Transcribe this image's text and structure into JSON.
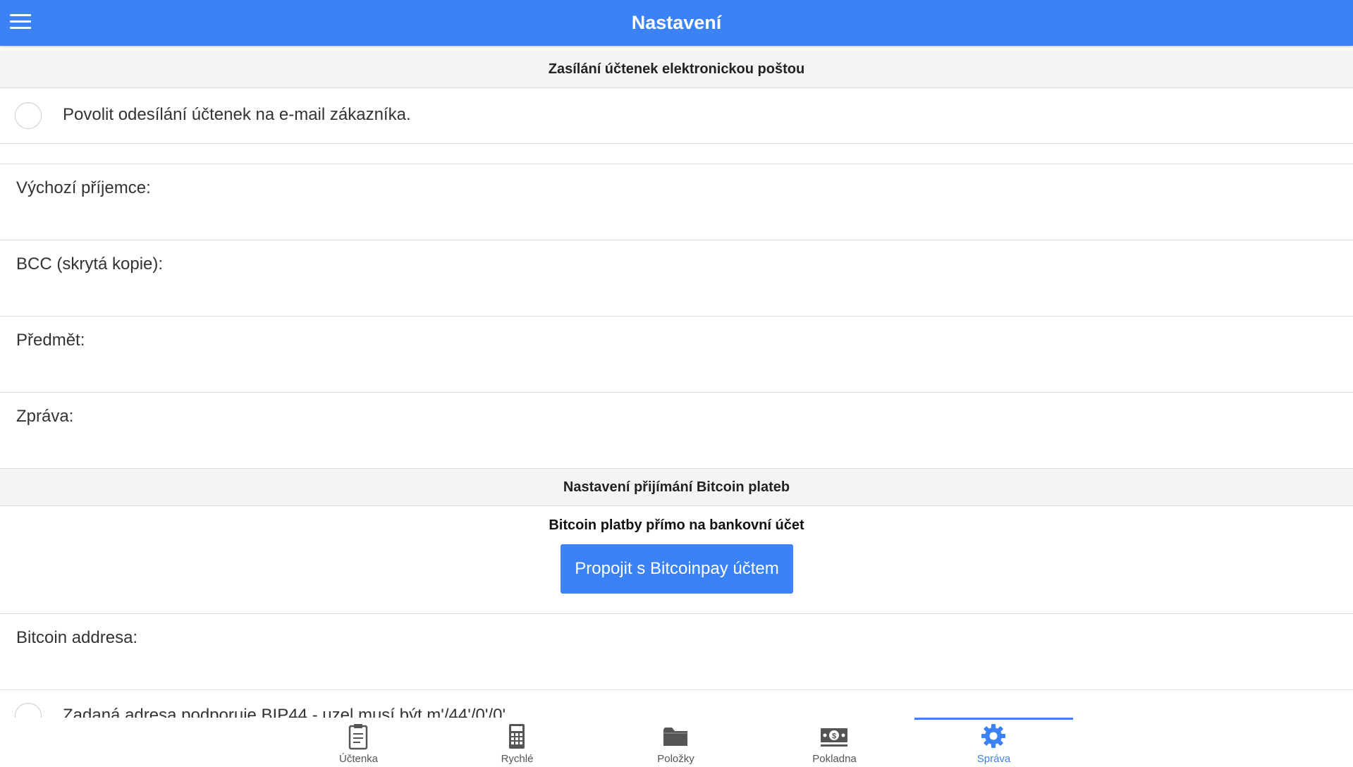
{
  "header": {
    "title": "Nastavení",
    "menu_icon": "hamburger-menu-icon",
    "color": "#3b82f6"
  },
  "email_section": {
    "title": "Zasílání účtenek elektronickou poštou",
    "enable_label": "Povolit odesílání účtenek na e-mail zákazníka.",
    "fields": [
      {
        "label": "Výchozí příjemce:",
        "value": ""
      },
      {
        "label": "BCC (skrytá kopie):",
        "value": ""
      },
      {
        "label": "Předmět:",
        "value": ""
      },
      {
        "label": "Zpráva:",
        "value": ""
      }
    ]
  },
  "bitcoin_section": {
    "title": "Nastavení přijímání Bitcoin plateb",
    "subtitle": "Bitcoin platby přímo na bankovní účet",
    "connect_button": "Propojit s Bitcoinpay účtem",
    "address_label": "Bitcoin addresa:",
    "address_value": "",
    "partial_option": "Zadaná adresa podporuje BIP44 - uzel musí být m'/44'/0'/0'"
  },
  "bottom_nav": {
    "active_color": "#3b82f6",
    "tabs": [
      {
        "label": "Účtenka",
        "icon": "receipt-clipboard-icon"
      },
      {
        "label": "Rychlé",
        "icon": "calculator-icon"
      },
      {
        "label": "Položky",
        "icon": "folder-icon"
      },
      {
        "label": "Pokladna",
        "icon": "cash-register-money-icon"
      },
      {
        "label": "Správa",
        "icon": "gear-icon",
        "active": true
      }
    ]
  }
}
